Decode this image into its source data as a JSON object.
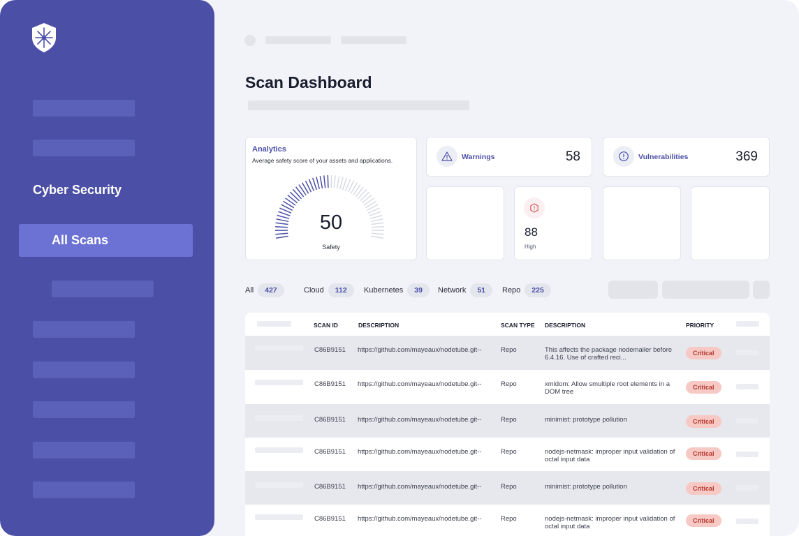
{
  "sidebar": {
    "section_label": "Cyber Security",
    "active_item": "All Scans"
  },
  "page": {
    "title": "Scan Dashboard"
  },
  "analytics": {
    "title": "Analytics",
    "description": "Average safety score of your assets and applications.",
    "score": "50",
    "score_label": "Safety"
  },
  "stats": {
    "warnings": {
      "label": "Warnings",
      "value": "58"
    },
    "vulnerabilities": {
      "label": "Vulnerabilities",
      "value": "369"
    },
    "high": {
      "label": "High",
      "value": "88"
    }
  },
  "filters": [
    {
      "label": "All",
      "count": "427"
    },
    {
      "label": "Cloud",
      "count": "112"
    },
    {
      "label": "Kubernetes",
      "count": "39"
    },
    {
      "label": "Network",
      "count": "51"
    },
    {
      "label": "Repo",
      "count": "225"
    }
  ],
  "table": {
    "headers": {
      "scan_id": "SCAN ID",
      "description": "DESCRIPTION",
      "scan_type": "SCAN TYPE",
      "description2": "DESCRIPTION",
      "priority": "PRIORITY"
    },
    "rows": [
      {
        "id": "C86B9151",
        "url": "https://github.com/mayeaux/nodetube.git--",
        "type": "Repo",
        "desc": "This affects the package nodemailer before 6.4.16. Use of crafted reci...",
        "priority": "Critical"
      },
      {
        "id": "C86B9151",
        "url": "https://github.com/mayeaux/nodetube.git--",
        "type": "Repo",
        "desc": "xmldom: Allow smultiple root elements in a DOM tree",
        "priority": "Critical"
      },
      {
        "id": "C86B9151",
        "url": "https://github.com/mayeaux/nodetube.git--",
        "type": "Repo",
        "desc": "minimist: prototype pollution",
        "priority": "Critical"
      },
      {
        "id": "C86B9151",
        "url": "https://github.com/mayeaux/nodetube.git--",
        "type": "Repo",
        "desc": "nodejs-netmask: improper input validation of octal input data",
        "priority": "Critical"
      },
      {
        "id": "C86B9151",
        "url": "https://github.com/mayeaux/nodetube.git--",
        "type": "Repo",
        "desc": "minimist: prototype pollution",
        "priority": "Critical"
      },
      {
        "id": "C86B9151",
        "url": "https://github.com/mayeaux/nodetube.git--",
        "type": "Repo",
        "desc": "nodejs-netmask: improper input validation of octal input data",
        "priority": "Critical"
      }
    ]
  },
  "icons": {
    "logo": "shield-star-icon",
    "warnings": "warning-triangle-icon",
    "vulnerabilities": "info-circle-icon",
    "high": "alert-hexagon-icon"
  },
  "colors": {
    "sidebar": "#4b4fa6",
    "accent": "#6c72d4",
    "critical_bg": "#f7c9c5",
    "critical_text": "#b4362d"
  }
}
